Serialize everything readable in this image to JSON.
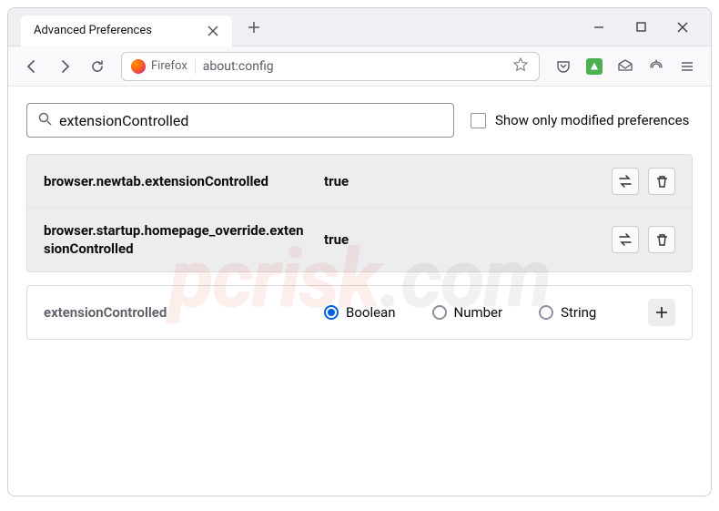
{
  "tab": {
    "title": "Advanced Preferences"
  },
  "addressbar": {
    "source_label": "Firefox",
    "url": "about:config"
  },
  "search": {
    "value": "extensionControlled",
    "modified_label": "Show only modified preferences"
  },
  "prefs": [
    {
      "name": "browser.newtab.extensionControlled",
      "value": "true"
    },
    {
      "name": "browser.startup.homepage_override.extensionControlled",
      "value": "true"
    }
  ],
  "new_pref": {
    "name": "extensionControlled",
    "types": [
      "Boolean",
      "Number",
      "String"
    ],
    "selected": "Boolean"
  },
  "watermark": {
    "brand": "pcrisk",
    "tld": ".com"
  }
}
